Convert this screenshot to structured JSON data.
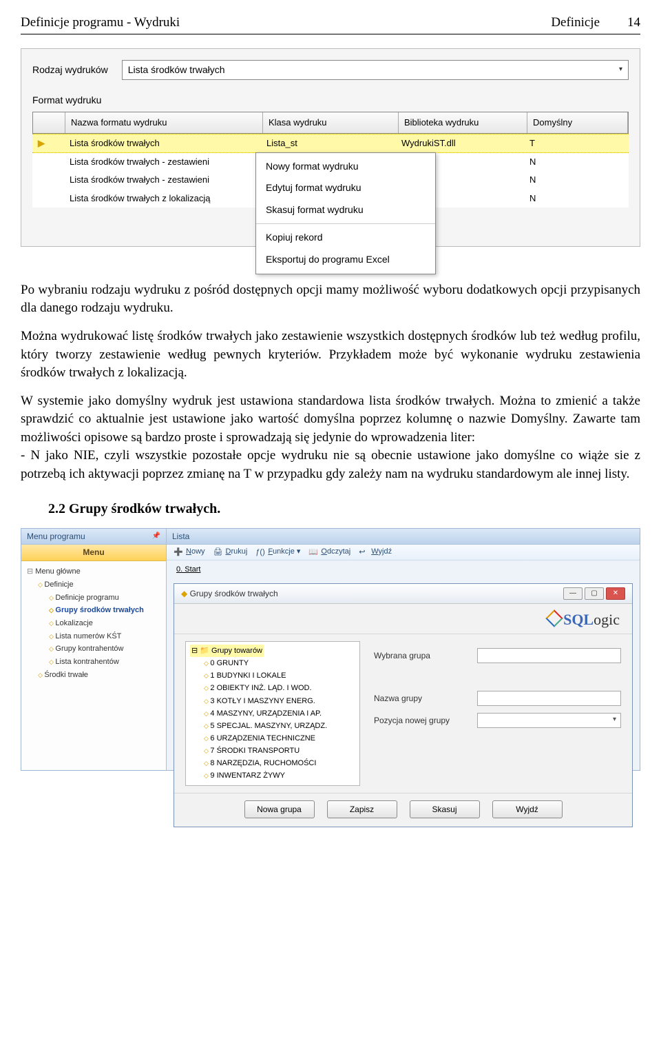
{
  "header": {
    "left": "Definicje programu - Wydruki",
    "rightLabel": "Definicje",
    "pageNum": "14"
  },
  "panel1": {
    "rodzajLabel": "Rodzaj wydruków",
    "rodzajValue": "Lista środków trwałych",
    "formatLabel": "Format wydruku",
    "headers": {
      "c1": "Nazwa formatu wydruku",
      "c2": "Klasa wydruku",
      "c3": "Biblioteka wydruku",
      "c4": "Domyślny"
    },
    "rows": [
      {
        "name": "Lista środków trwałych",
        "klass": "Lista_st",
        "lib": "WydrukiST.dll",
        "dom": "T",
        "sel": true
      },
      {
        "name": "Lista środków trwałych - zestawieni",
        "klass": "",
        "lib": "",
        "dom": "N"
      },
      {
        "name": "Lista środków trwałych - zestawieni",
        "klass": "",
        "lib": "",
        "dom": "N"
      },
      {
        "name": "Lista środków trwałych z lokalizacją",
        "klass": "",
        "lib": "",
        "dom": "N"
      }
    ],
    "ctx": {
      "i1": "Nowy format wydruku",
      "i2": "Edytuj format wydruku",
      "i3": "Skasuj format wydruku",
      "i4": "Kopiuj rekord",
      "i5": "Eksportuj do programu Excel"
    }
  },
  "paragraphs": {
    "p1": "Po wybraniu rodzaju wydruku z pośród dostępnych opcji mamy możliwość wyboru dodatkowych opcji przypisanych dla danego rodzaju wydruku.",
    "p2": "Można wydrukować listę środków trwałych jako zestawienie wszystkich dostępnych środków lub też według profilu, który tworzy zestawienie według pewnych kryteriów. Przykładem może być wykonanie wydruku zestawienia środków trwałych z lokalizacją.",
    "p3a": "W systemie jako domyślny wydruk jest ustawiona standardowa lista środków trwałych. Można to zmienić a także sprawdzić co aktualnie jest ustawione jako wartość domyślna poprzez kolumnę o nazwie Domyślny. Zawarte tam możliwości opisowe są bardzo proste i sprowadzają się jedynie do wprowadzenia liter:",
    "p3b": "- N jako NIE, czyli wszystkie pozostałe opcje wydruku nie są obecnie ustawione jako domyślne co wiąże sie z potrzebą ich aktywacji poprzez zmianę na T w przypadku gdy zależy nam na wydruku standardowym ale innej listy."
  },
  "subhead": "2.2 Grupy środków trwałych.",
  "app2": {
    "sidebarTitle": "Menu programu",
    "menuLabel": "Menu",
    "tree": {
      "root": "Menu główne",
      "n1": "Definicje",
      "n1a": "Definicje programu",
      "n1b": "Grupy środków trwałych",
      "n1c": "Lokalizacje",
      "n1d": "Lista numerów KŚT",
      "n1e": "Grupy kontrahentów",
      "n1f": "Lista kontrahentów",
      "n2": "Środki trwałe"
    },
    "listTitle": "Lista",
    "toolbar": {
      "nowy": "Nowy",
      "drukuj": "Drukuj",
      "funkcje": "Funkcje",
      "odczytaj": "Odczytaj",
      "wyjdz": "Wyjdź"
    },
    "tab": "0. Start",
    "winTitle": "Grupy środków trwałych",
    "logo": "SQLogic",
    "gtree": {
      "root": "Grupy towarów",
      "items": [
        "0 GRUNTY",
        "1 BUDYNKI I LOKALE",
        "2 OBIEKTY INŻ. LĄD. I WOD.",
        "3 KOTŁY I MASZYNY ENERG.",
        "4 MASZYNY, URZĄDZENIA I AP.",
        "5 SPECJAL. MASZYNY, URZĄDZ.",
        "6 URZĄDZENIA TECHNICZNE",
        "7 ŚRODKI TRANSPORTU",
        "8 NARZĘDZIA, RUCHOMOŚCI",
        "9 INWENTARZ ŻYWY"
      ]
    },
    "form": {
      "wybrana": "Wybrana grupa",
      "nazwa": "Nazwa grupy",
      "pozycja": "Pozycja nowej grupy"
    },
    "buttons": {
      "nowa": "Nowa grupa",
      "zapisz": "Zapisz",
      "skasuj": "Skasuj",
      "wyjdz": "Wyjdź"
    }
  }
}
